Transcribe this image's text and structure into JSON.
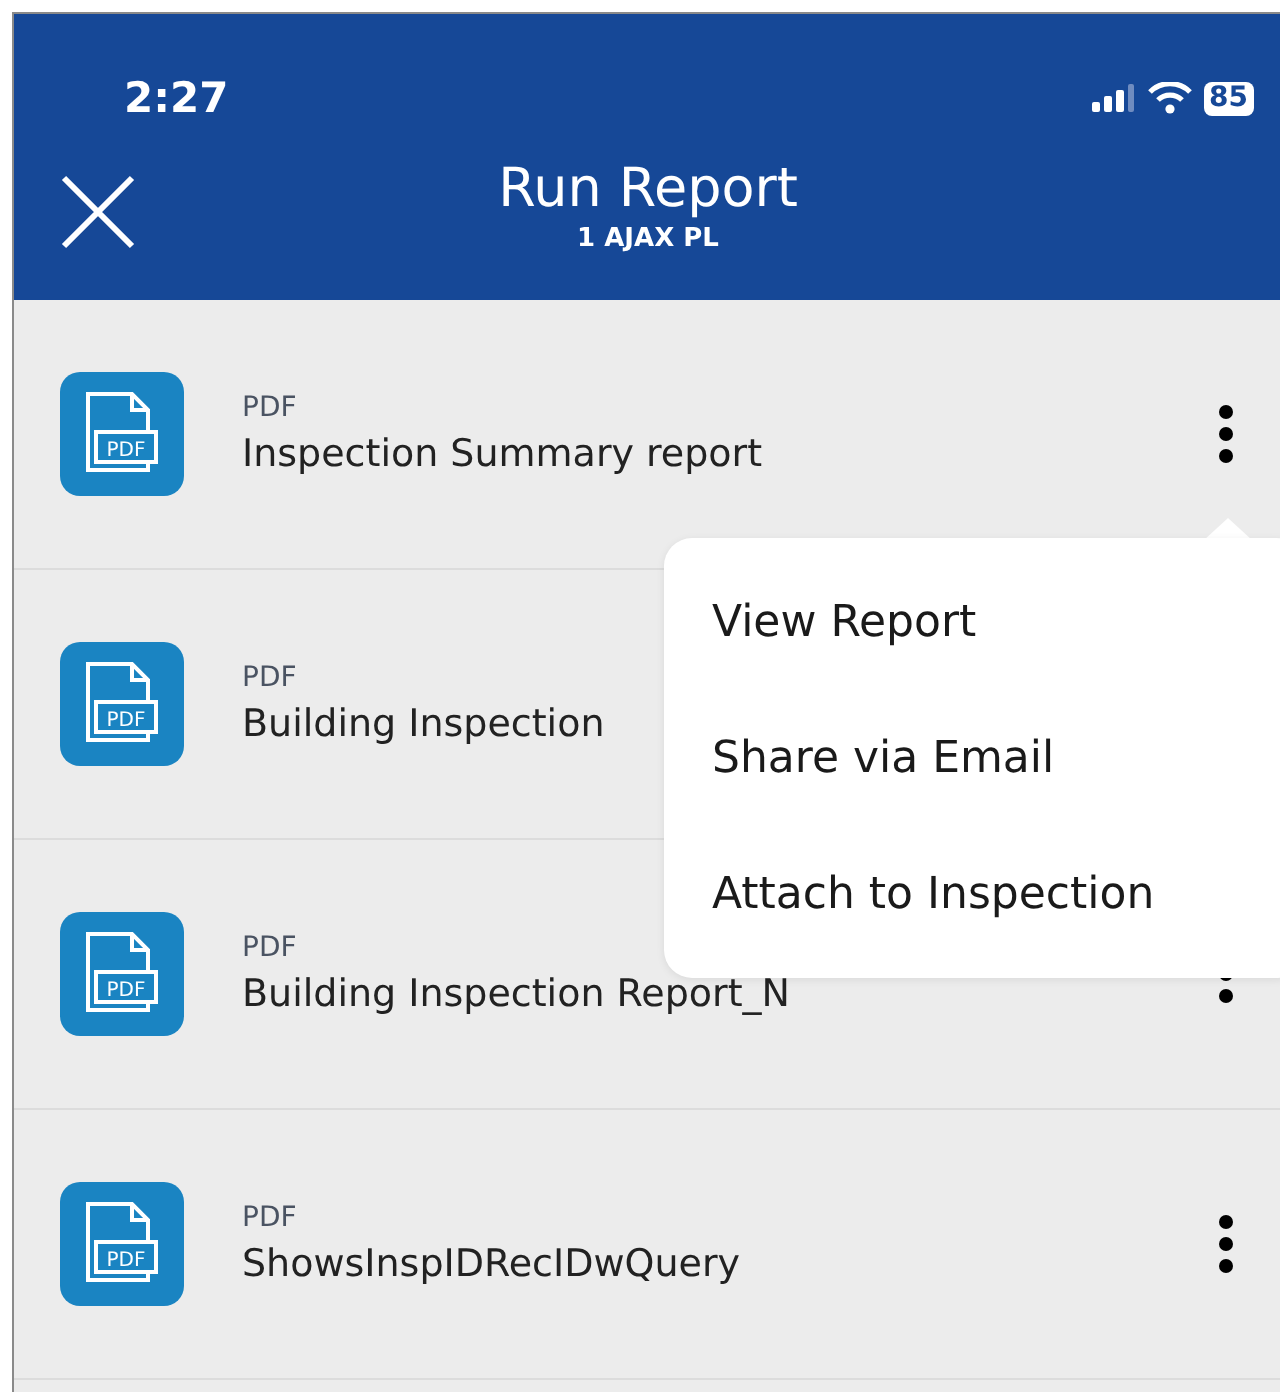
{
  "status_bar": {
    "time": "2:27",
    "battery": "85"
  },
  "header": {
    "title": "Run Report",
    "subtitle": "1 AJAX PL"
  },
  "reports": [
    {
      "icon_label": "PDF",
      "type": "PDF",
      "name": "Inspection Summary report",
      "menu_open": true
    },
    {
      "icon_label": "PDF",
      "type": "PDF",
      "name": "Building Inspection",
      "menu_open": false
    },
    {
      "icon_label": "PDF",
      "type": "PDF",
      "name": "Building Inspection Report_N",
      "menu_open": false
    },
    {
      "icon_label": "PDF",
      "type": "PDF",
      "name": "ShowsInspIDRecIDwQuery",
      "menu_open": false
    }
  ],
  "menu": {
    "items": [
      "View Report",
      "Share via Email",
      "Attach to Inspection"
    ]
  }
}
